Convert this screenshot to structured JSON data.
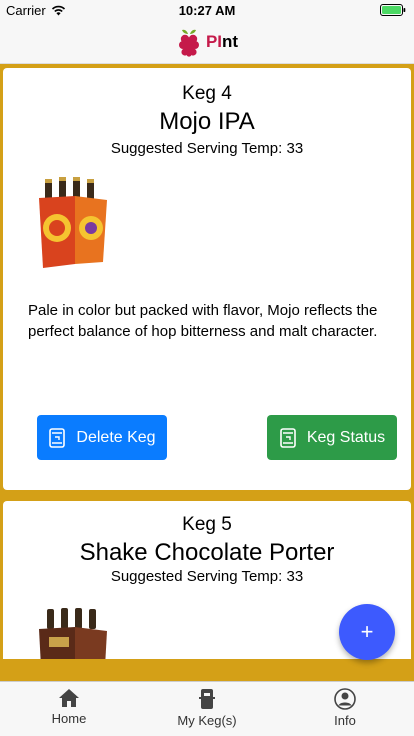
{
  "status_bar": {
    "carrier": "Carrier",
    "time": "10:27 AM"
  },
  "header": {
    "brand_pi": "PI",
    "brand_rest": "nt"
  },
  "kegs": [
    {
      "keg_label": "Keg 4",
      "name": "Mojo IPA",
      "serving_temp": "Suggested Serving Temp: 33",
      "description": "Pale in color but packed with flavor, Mojo reflects the perfect balance of hop bitterness and malt character."
    },
    {
      "keg_label": "Keg 5",
      "name": "Shake Chocolate Porter",
      "serving_temp": "Suggested Serving Temp: 33"
    }
  ],
  "actions": {
    "delete_label": "Delete Keg",
    "status_label": "Keg Status"
  },
  "fab": {
    "icon": "plus-icon",
    "label": "+"
  },
  "tabs": [
    {
      "label": "Home",
      "icon": "home-icon"
    },
    {
      "label": "My Keg(s)",
      "icon": "keg-icon"
    },
    {
      "label": "Info",
      "icon": "person-icon"
    }
  ],
  "colors": {
    "background": "#d4a017",
    "delete_button": "#0a7cff",
    "status_button": "#2d9b48",
    "fab": "#3d5afe",
    "battery": "#4cd964",
    "brand_accent": "#c51a4a"
  }
}
